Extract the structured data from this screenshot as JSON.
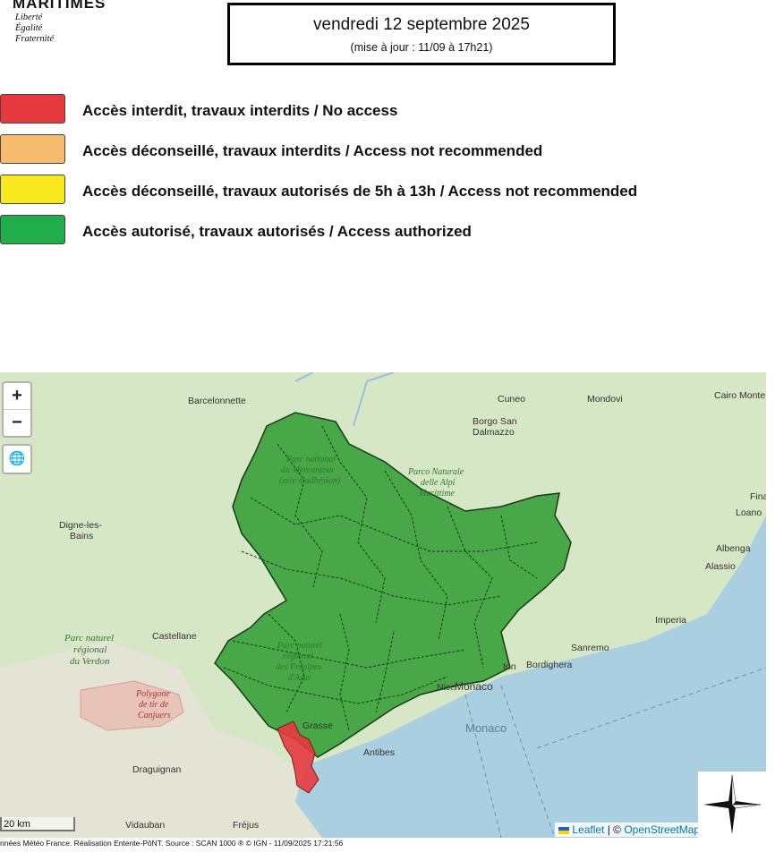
{
  "header": {
    "department": "MARITIMES",
    "motto": [
      "Liberté",
      "Égalité",
      "Fraternité"
    ],
    "date": "vendredi 12 septembre 2025",
    "update": "(mise à jour : 11/09 à 17h21)"
  },
  "legend": [
    {
      "color": "#e63a3f",
      "label": "Accès interdit, travaux interdits / No access"
    },
    {
      "color": "#f6bb6e",
      "label": "Accès déconseillé, travaux interdits / Access not recommended"
    },
    {
      "color": "#f8ea1e",
      "label": "Accès déconseillé, travaux autorisés de 5h à 13h / Access not recommended"
    },
    {
      "color": "#22ad4b",
      "label": "Accès autorisé, travaux autorisés / Access authorized"
    }
  ],
  "map": {
    "zoom_in": "+",
    "zoom_out": "−",
    "layers_icon": "globe-icon",
    "scale": "20 km",
    "attribution_leaflet": "Leaflet",
    "attribution_sep": " | © ",
    "attribution_osm": "OpenStreetMap",
    "places": {
      "barcelonnette": "Barcelonnette",
      "cuneo": "Cuneo",
      "mondovi": "Mondovi",
      "cairo": "Cairo Monte",
      "borgo": "Borgo San",
      "dalmazzo": "Dalmazzo",
      "digne1": "Digne-les-",
      "digne2": "Bains",
      "castellane": "Castellane",
      "draguignan": "Draguignan",
      "vidauban": "Vidauban",
      "frejus": "Fréjus",
      "grasse": "Grasse",
      "antibes": "Antibes",
      "monaco_city": "Monaco",
      "monaco_sea": "Monaco",
      "sanremo": "Sanremo",
      "imperia": "Imperia",
      "bordighera": "Bordighera",
      "alassio": "Alassio",
      "albenga": "Albenga",
      "loano": "Loano",
      "fina": "Fina",
      "ton": "ton",
      "nice": "Nice"
    },
    "parks": {
      "mercantour": [
        "Parc national",
        "du Mercantour",
        "(aire d'adhésion)"
      ],
      "alpi": [
        "Parco Naturale",
        "delle Alpi",
        "Marittime"
      ],
      "verdon": [
        "Parc naturel",
        "régional",
        "du Verdon"
      ],
      "canjuers": [
        "Polygone",
        "de tir de",
        "Canjuers"
      ],
      "prealpes": [
        "Parc naturel",
        "régional",
        "des Préalpes",
        "d'Azur"
      ]
    },
    "colors": {
      "authorized": "#2f9b2f",
      "no_access": "#e63a3f",
      "sea": "#a9cfe0",
      "land": "#d6e7c6"
    }
  },
  "footer": "nnées Météo France. Réalisation Entente-PôNT. Source : SCAN 1000 ® © IGN - 11/09/2025 17:21:56"
}
